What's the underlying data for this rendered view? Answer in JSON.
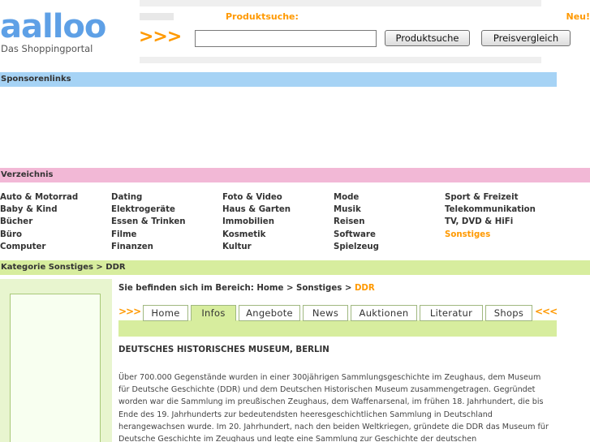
{
  "header": {
    "logo_text": "aalloo",
    "logo_tagline": "Das Shoppingportal",
    "search_title": "Produktsuche:",
    "neu_label": "Neu!",
    "arrows": ">>>",
    "search_input_value": "",
    "search_button_label": "Produktsuche",
    "price_button_label": "Preisvergleich"
  },
  "sponsor_bar": {
    "label": "Sponsorenlinks"
  },
  "directory_bar": {
    "label": "Verzeichnis"
  },
  "directory": {
    "columns": [
      {
        "items": [
          "Auto & Motorrad",
          "Baby & Kind",
          "Bücher",
          "Büro",
          "Computer"
        ]
      },
      {
        "items": [
          "Dating",
          "Elektrogeräte",
          "Essen & Trinken",
          "Filme",
          "Finanzen"
        ]
      },
      {
        "items": [
          "Foto & Video",
          "Haus & Garten",
          "Immobilien",
          "Kosmetik",
          "Kultur"
        ]
      },
      {
        "items": [
          "Mode",
          "Musik",
          "Reisen",
          "Software",
          "Spielzeug"
        ]
      },
      {
        "items": [
          "Sport & Freizeit",
          "Telekommunikation",
          "TV, DVD & HiFi",
          "Sonstiges"
        ]
      }
    ],
    "active_item": "Sonstiges"
  },
  "category_bar": {
    "label": "Kategorie Sonstiges > DDR"
  },
  "breadcrumb": {
    "prefix": "Sie befinden sich im Bereich: Home > Sonstiges > ",
    "current": "DDR"
  },
  "tabs": {
    "left_arrows": ">>>",
    "right_arrows": "<<<",
    "items": [
      {
        "label": "Home",
        "active": false
      },
      {
        "label": "Infos",
        "active": true
      },
      {
        "label": "Angebote",
        "active": false
      },
      {
        "label": "News",
        "active": false
      },
      {
        "label": "Auktionen",
        "active": false
      },
      {
        "label": "Literatur",
        "active": false
      },
      {
        "label": "Shops",
        "active": false
      }
    ]
  },
  "article": {
    "title": "DEUTSCHES HISTORISCHES MUSEUM, BERLIN",
    "lines": [
      "Über 700.000 Gegenstände wurden in einer 300jährigen Sammlungsgeschichte im Zeughaus, dem Museum",
      "für Deutsche Geschichte (DDR) und dem Deutschen Historischen Museum zusammengetragen. Gegründet",
      "worden war die Sammlung im preußischen Zeughaus, dem Waffenarsenal, im frühen 18. Jahrhundert, die bis",
      "Ende des 19. Jahrhunderts zur bedeutendsten heeresgeschichtlichen Sammlung in Deutschland",
      "herangewachsen wurde. Im 20. Jahrhundert, nach den beiden Weltkriegen, gründete die DDR das Museum für",
      "Deutsche Geschichte im Zeughaus und legte eine Sammlung zur Geschichte der deutschen"
    ]
  },
  "colors": {
    "accent_orange": "#ff9900",
    "logo_blue": "#5ea0e6",
    "sponsor_blue": "#a6d3f5",
    "directory_pink": "#f2b8d6",
    "category_green": "#d7ed9e"
  }
}
